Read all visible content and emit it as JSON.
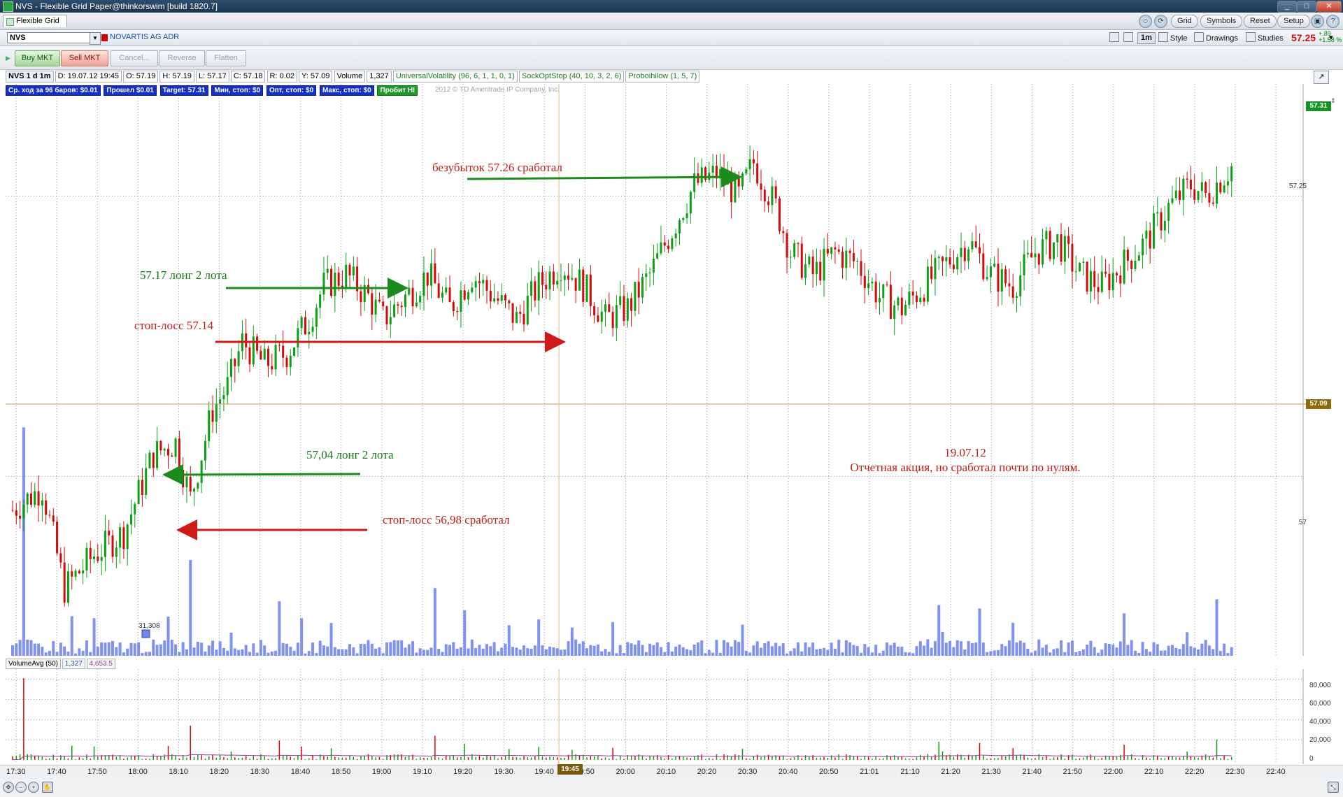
{
  "window": {
    "title": "NVS - Flexible Grid Paper@thinkorswim [build 1820.7]",
    "minimize": "_",
    "maximize": "□",
    "close": "✕"
  },
  "toolbar": {
    "tab_label": "Flexible Grid",
    "grid": "Grid",
    "symbols": "Symbols",
    "reset": "Reset",
    "setup": "Setup"
  },
  "symbol": {
    "ticker": "NVS",
    "name": "NOVARTIS AG ADR",
    "aggregation": "1m",
    "style": "Style",
    "drawings": "Drawings",
    "studies": "Studies",
    "last": "57.25",
    "change_abs": "+.89",
    "change_pct": "+1.58 %"
  },
  "orders": {
    "buy": "Buy MKT",
    "sell": "Sell MKT",
    "cancel": "Cancel...",
    "reverse": "Reverse",
    "flatten": "Flatten"
  },
  "info": {
    "sym": "NVS 1 d 1m",
    "date": "D: 19.07.12 19:45",
    "open": "O: 57.19",
    "high": "H: 57.19",
    "low": "L: 57.17",
    "close": "C: 57.18",
    "range": "R: 0.02",
    "y": "Y: 57.09",
    "volume_label": "Volume",
    "volume": "1,327",
    "study1": "UniversalVolatility (96, 6, 1, 1, 0, 1)",
    "study2": "SockOptStop (40, 10, 3, 2, 6)",
    "study3": "Proboihilow (1, 5, 7)"
  },
  "status": {
    "s1": "Ср. ход за 96 баров: $0.01",
    "s2": "Прошел $0.01",
    "s3": "Target: 57.31",
    "s4": "Мин, стоп: $0",
    "s5": "Опт, стоп: $0",
    "s6": "Макс, стоп: $0",
    "s7": "Пробит HI",
    "copyright": "2012 © TD Ameritrade IP Company, Inc."
  },
  "annotations": {
    "breakeven": "безубыток 57.26 сработал",
    "long1": "57.17 лонг 2 лота",
    "stop1": "стоп-лосс 57.14",
    "long2": "57,04 лонг 2 лота",
    "stop2": "стоп-лосс 56,98 сработал",
    "note_date": "19.07.12",
    "note_text": "Отчетная акция, но сработал почти по нулям.",
    "volume_marker": "31,308"
  },
  "price_axis": {
    "ticks": [
      "57.25",
      "57",
      "57.31",
      "57.09"
    ]
  },
  "volume_study": {
    "name": "VolumeAvg (50)",
    "value": "1,327",
    "avg": "4,653.5",
    "ticks": [
      "80,000",
      "60,000",
      "40,000",
      "20,000",
      "0"
    ]
  },
  "time_axis": {
    "labels": [
      "17:30",
      "17:40",
      "17:50",
      "18:00",
      "18:10",
      "18:20",
      "18:30",
      "18:40",
      "18:50",
      "19:00",
      "19:10",
      "19:20",
      "19:30",
      "19:40",
      "19:50",
      "20:00",
      "20:10",
      "20:20",
      "20:30",
      "20:40",
      "20:50",
      "21:01",
      "21:10",
      "21:20",
      "21:30",
      "21:40",
      "21:50",
      "22:00",
      "22:10",
      "22:20",
      "22:30",
      "22:40"
    ],
    "cursor": "19:45"
  },
  "chart_data": {
    "type": "candlestick",
    "title": "NVS 1 d 1m",
    "ylim": [
      56.84,
      57.35
    ],
    "crosshair": 57.09,
    "horizontal_levels": [
      57.25,
      57.0
    ],
    "volume_ylim": [
      0,
      90000
    ],
    "volume_ticks": [
      0,
      20000,
      40000,
      60000,
      80000
    ],
    "volume_peak": 81000,
    "colors": {
      "up": "#0aa012",
      "down": "#d40a0a",
      "volume": "#7186ef",
      "volume_avg": "#a0379a",
      "grid": "#8a96a0"
    }
  }
}
